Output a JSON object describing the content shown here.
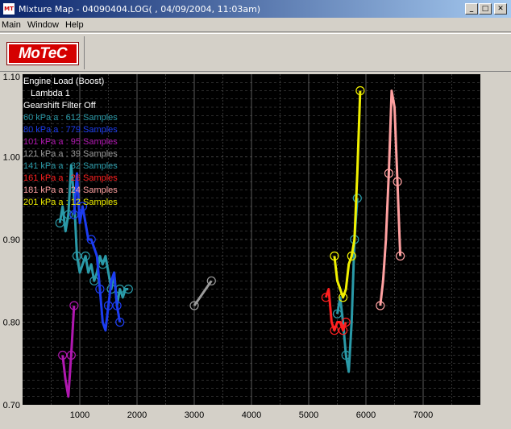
{
  "window": {
    "title": "Mixture Map - 04090404.LOG( , 04/09/2004, 11:03am)",
    "app_icon_text": "MT",
    "minimize_glyph": "_",
    "maximize_glyph": "□",
    "close_glyph": "✕"
  },
  "menu": {
    "items": [
      {
        "label": "Main"
      },
      {
        "label": "Window"
      },
      {
        "label": "Help"
      }
    ]
  },
  "toolbar": {
    "logo_text": "MoTeC"
  },
  "colors": {
    "plot_background": "#000000",
    "grid": "#5a5a5a",
    "frame": "#d4d0c8"
  },
  "chart_data": {
    "type": "line",
    "xlim": [
      0,
      8000
    ],
    "ylim": [
      0.7,
      1.1
    ],
    "x_ticks": [
      "1000",
      "2000",
      "3000",
      "4000",
      "5000",
      "6000",
      "7000"
    ],
    "y_ticks": [
      "1.10",
      "1.00",
      "0.90",
      "0.80",
      "0.70"
    ],
    "grid": true,
    "legend_placement": "top-left",
    "header_lines": [
      "Engine Load (Boost)",
      "Lambda 1",
      "Gearshift Filter Off"
    ],
    "series": [
      {
        "name": "60 kPa a : 612 Samples",
        "color": "#2a9aa8",
        "points": [
          [
            650,
            0.92
          ],
          [
            700,
            0.94
          ],
          [
            750,
            0.91
          ],
          [
            800,
            0.93
          ],
          [
            850,
            0.99
          ],
          [
            900,
            0.95
          ],
          [
            950,
            0.88
          ],
          [
            1000,
            0.86
          ],
          [
            1050,
            0.87
          ],
          [
            1100,
            0.88
          ],
          [
            1150,
            0.86
          ],
          [
            1200,
            0.87
          ],
          [
            1250,
            0.85
          ],
          [
            1300,
            0.86
          ],
          [
            1350,
            0.88
          ],
          [
            1400,
            0.87
          ],
          [
            1450,
            0.88
          ],
          [
            1500,
            0.86
          ],
          [
            1550,
            0.84
          ],
          [
            1600,
            0.86
          ],
          [
            1650,
            0.82
          ],
          [
            1700,
            0.84
          ],
          [
            1750,
            0.83
          ],
          [
            1800,
            0.84
          ],
          [
            1850,
            0.84
          ]
        ]
      },
      {
        "name": "80 kPa a : 779 Samples",
        "color": "#1c3cf0",
        "points": [
          [
            900,
            0.93
          ],
          [
            950,
            0.98
          ],
          [
            1000,
            0.92
          ],
          [
            1050,
            0.94
          ],
          [
            1100,
            0.92
          ],
          [
            1150,
            0.9
          ],
          [
            1200,
            0.9
          ],
          [
            1250,
            0.89
          ],
          [
            1300,
            0.88
          ],
          [
            1350,
            0.84
          ],
          [
            1400,
            0.8
          ],
          [
            1450,
            0.79
          ],
          [
            1500,
            0.82
          ],
          [
            1550,
            0.85
          ],
          [
            1600,
            0.86
          ],
          [
            1650,
            0.82
          ],
          [
            1700,
            0.8
          ]
        ]
      },
      {
        "name": "101 kPa a : 95 Samples",
        "color": "#b018b0",
        "points": [
          [
            700,
            0.76
          ],
          [
            750,
            0.73
          ],
          [
            800,
            0.71
          ],
          [
            850,
            0.76
          ],
          [
            900,
            0.82
          ]
        ]
      },
      {
        "name": "121 kPa a : 39 Samples",
        "color": "#9a9a9a",
        "points": [
          [
            3000,
            0.82
          ],
          [
            3100,
            0.83
          ],
          [
            3200,
            0.84
          ],
          [
            3300,
            0.85
          ]
        ]
      },
      {
        "name": "141 kPa a : 32 Samples",
        "color": "#2a9aa8",
        "points": [
          [
            5500,
            0.81
          ],
          [
            5550,
            0.83
          ],
          [
            5600,
            0.8
          ],
          [
            5650,
            0.76
          ],
          [
            5700,
            0.74
          ],
          [
            5750,
            0.8
          ],
          [
            5800,
            0.9
          ],
          [
            5850,
            0.95
          ]
        ]
      },
      {
        "name": "161 kPa a : 26 Samples",
        "color": "#ff2020",
        "points": [
          [
            5300,
            0.83
          ],
          [
            5350,
            0.84
          ],
          [
            5400,
            0.8
          ],
          [
            5450,
            0.79
          ],
          [
            5500,
            0.8
          ],
          [
            5550,
            0.8
          ],
          [
            5600,
            0.79
          ],
          [
            5650,
            0.8
          ]
        ]
      },
      {
        "name": "181 kPa a : 24 Samples",
        "color": "#ffa0a0",
        "points": [
          [
            6250,
            0.82
          ],
          [
            6300,
            0.85
          ],
          [
            6350,
            0.9
          ],
          [
            6400,
            0.98
          ],
          [
            6450,
            1.08
          ],
          [
            6500,
            1.06
          ],
          [
            6550,
            0.97
          ],
          [
            6600,
            0.88
          ]
        ]
      },
      {
        "name": "201 kPa a : 12 Samples",
        "color": "#f0f000",
        "points": [
          [
            5450,
            0.88
          ],
          [
            5500,
            0.85
          ],
          [
            5550,
            0.84
          ],
          [
            5600,
            0.83
          ],
          [
            5650,
            0.84
          ],
          [
            5700,
            0.87
          ],
          [
            5750,
            0.88
          ],
          [
            5800,
            0.9
          ],
          [
            5850,
            0.98
          ],
          [
            5900,
            1.08
          ]
        ]
      }
    ]
  }
}
